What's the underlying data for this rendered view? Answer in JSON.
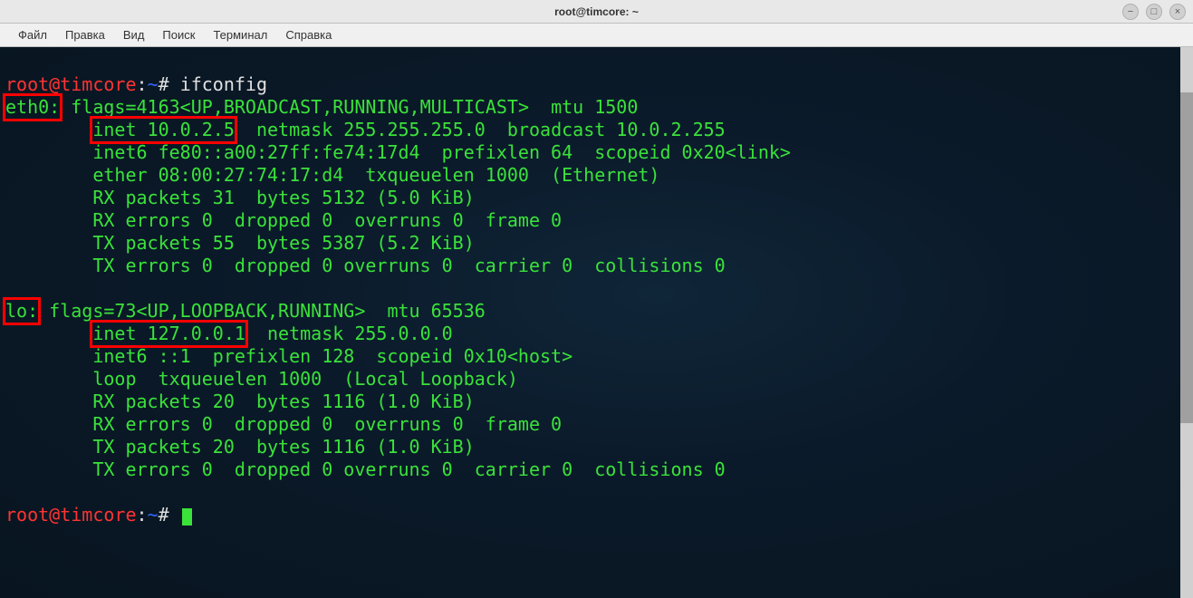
{
  "window": {
    "title": "root@timcore: ~"
  },
  "menu": {
    "file": "Файл",
    "edit": "Правка",
    "view": "Вид",
    "search": "Поиск",
    "terminal": "Терминал",
    "help": "Справка"
  },
  "prompt": {
    "user_host": "root@timcore",
    "sep": ":",
    "path": "~",
    "sym": "#"
  },
  "command": "ifconfig",
  "eth0": {
    "iface": "eth0:",
    "flags": " flags=4163<UP,BROADCAST,RUNNING,MULTICAST>  mtu 1500",
    "inet": "inet 10.0.2.5",
    "inet_rest": "  netmask 255.255.255.0  broadcast 10.0.2.255",
    "inet6": "        inet6 fe80::a00:27ff:fe74:17d4  prefixlen 64  scopeid 0x20<link>",
    "ether": "        ether 08:00:27:74:17:d4  txqueuelen 1000  (Ethernet)",
    "rxp": "        RX packets 31  bytes 5132 (5.0 KiB)",
    "rxe": "        RX errors 0  dropped 0  overruns 0  frame 0",
    "txp": "        TX packets 55  bytes 5387 (5.2 KiB)",
    "txe": "        TX errors 0  dropped 0 overruns 0  carrier 0  collisions 0"
  },
  "lo": {
    "iface": "lo:",
    "flags": " flags=73<UP,LOOPBACK,RUNNING>  mtu 65536",
    "inet": "inet 127.0.0.1",
    "inet_rest": "  netmask 255.0.0.0",
    "inet6": "        inet6 ::1  prefixlen 128  scopeid 0x10<host>",
    "loop": "        loop  txqueuelen 1000  (Local Loopback)",
    "rxp": "        RX packets 20  bytes 1116 (1.0 KiB)",
    "rxe": "        RX errors 0  dropped 0  overruns 0  frame 0",
    "txp": "        TX packets 20  bytes 1116 (1.0 KiB)",
    "txe": "        TX errors 0  dropped 0 overruns 0  carrier 0  collisions 0"
  },
  "spacing": {
    "indent8": "        "
  }
}
